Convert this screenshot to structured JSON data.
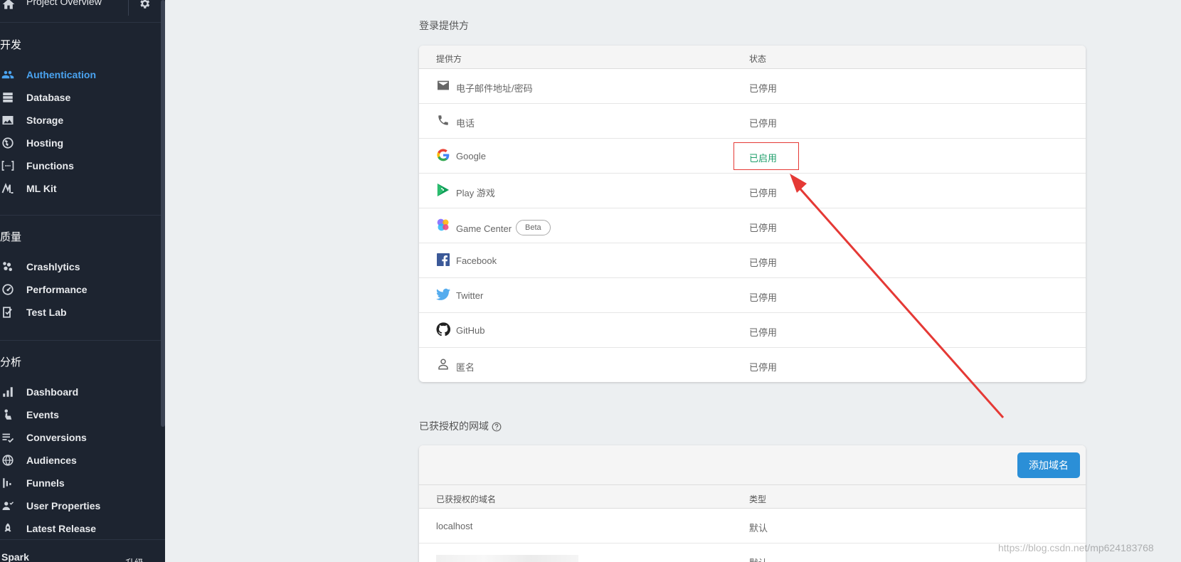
{
  "sidebar": {
    "project_overview": "Project Overview",
    "sections": [
      {
        "title": "开发",
        "items": [
          {
            "label": "Authentication",
            "icon": "users-icon",
            "active": true
          },
          {
            "label": "Database",
            "icon": "database-icon"
          },
          {
            "label": "Storage",
            "icon": "image-icon"
          },
          {
            "label": "Hosting",
            "icon": "globe-icon"
          },
          {
            "label": "Functions",
            "icon": "functions-icon"
          },
          {
            "label": "ML Kit",
            "icon": "mlkit-icon"
          }
        ]
      },
      {
        "title": "质量",
        "items": [
          {
            "label": "Crashlytics",
            "icon": "crashlytics-icon"
          },
          {
            "label": "Performance",
            "icon": "gauge-icon"
          },
          {
            "label": "Test Lab",
            "icon": "test-lab-icon"
          }
        ]
      },
      {
        "title": "分析",
        "items": [
          {
            "label": "Dashboard",
            "icon": "bar-chart-icon"
          },
          {
            "label": "Events",
            "icon": "touch-icon"
          },
          {
            "label": "Conversions",
            "icon": "conversions-icon"
          },
          {
            "label": "Audiences",
            "icon": "audience-globe-icon"
          },
          {
            "label": "Funnels",
            "icon": "funnel-icon"
          },
          {
            "label": "User Properties",
            "icon": "user-properties-icon"
          },
          {
            "label": "Latest Release",
            "icon": "rocket-icon"
          }
        ]
      }
    ],
    "plan": "Spark",
    "upgrade": "升级"
  },
  "providers": {
    "title": "登录提供方",
    "col_provider": "提供方",
    "col_status": "状态",
    "rows": [
      {
        "name": "电子邮件地址/密码",
        "status": "已停用",
        "icon": "email-icon"
      },
      {
        "name": "电话",
        "status": "已停用",
        "icon": "phone-icon"
      },
      {
        "name": "Google",
        "status": "已启用",
        "icon": "google-icon",
        "enabled": true
      },
      {
        "name": "Play 游戏",
        "status": "已停用",
        "icon": "play-games-icon"
      },
      {
        "name": "Game Center",
        "status": "已停用",
        "icon": "game-center-icon",
        "badge": "Beta"
      },
      {
        "name": "Facebook",
        "status": "已停用",
        "icon": "facebook-icon"
      },
      {
        "name": "Twitter",
        "status": "已停用",
        "icon": "twitter-icon"
      },
      {
        "name": "GitHub",
        "status": "已停用",
        "icon": "github-icon"
      },
      {
        "name": "匿名",
        "status": "已停用",
        "icon": "anonymous-icon"
      }
    ]
  },
  "domains": {
    "title": "已获授权的网域",
    "add_button": "添加域名",
    "col_domain": "已获授权的域名",
    "col_type": "类型",
    "rows": [
      {
        "domain": "localhost",
        "type": "默认"
      },
      {
        "domain": "",
        "type": "默认"
      }
    ]
  },
  "watermark": "https://blog.csdn.net/mp624183768",
  "colors": {
    "sidebar_bg": "#1d2430",
    "active": "#4aa3f0",
    "enabled_status": "#1e9e6a",
    "annotation_red": "#e53935",
    "button_blue": "#2b8fd7"
  }
}
